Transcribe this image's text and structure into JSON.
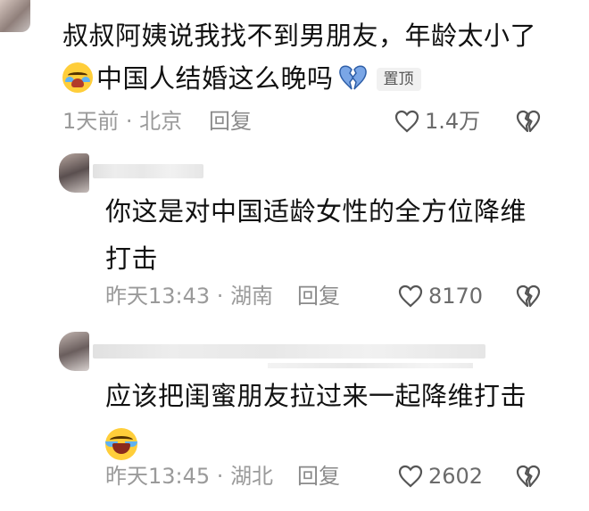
{
  "main_comment": {
    "text_line1": "叔叔阿姨说我找不到男朋友，年龄太小了",
    "text_line2": "中国人结婚这么晚吗",
    "pinned_badge": "置顶",
    "meta": {
      "time": "1天前",
      "separator": " · ",
      "location": "北京",
      "reply_label": "回复"
    },
    "likes": "1.4万"
  },
  "replies": [
    {
      "text": "你这是对中国适龄女性的全方位降维打击",
      "meta": {
        "time": "昨天13:43",
        "separator": " · ",
        "location": "湖南",
        "reply_label": "回复"
      },
      "likes": "8170"
    },
    {
      "text": "应该把闺蜜朋友拉过来一起降维打击",
      "meta": {
        "time": "昨天13:45",
        "separator": " · ",
        "location": "湖北",
        "reply_label": "回复"
      },
      "likes": "2602"
    }
  ],
  "icons": {
    "like": "heart-outline-icon",
    "dislike": "broken-heart-outline-icon",
    "emoji_cry": "crying-face-emoji-icon",
    "emoji_broken_heart": "broken-heart-emoji-icon",
    "emoji_laugh": "laughing-face-emoji-icon"
  },
  "colors": {
    "meta_text": "#9a9a9a",
    "like_text": "#6b6b6b",
    "broken_heart_emoji": "#7aa6e6"
  }
}
